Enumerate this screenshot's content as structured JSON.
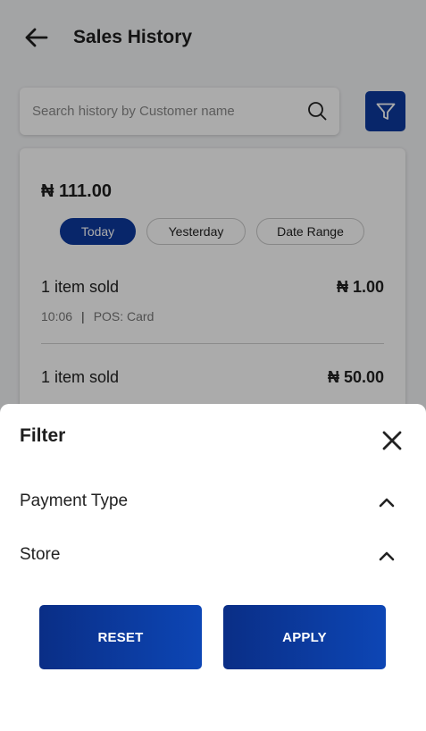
{
  "header": {
    "title": "Sales History"
  },
  "search": {
    "placeholder": "Search history by Customer name"
  },
  "summary": {
    "total": "₦ 111.00"
  },
  "period_tabs": [
    {
      "label": "Today",
      "active": true
    },
    {
      "label": "Yesterday",
      "active": false
    },
    {
      "label": "Date Range",
      "active": false
    }
  ],
  "transactions": [
    {
      "items": "1 item sold",
      "amount": "₦ 1.00",
      "time": "10:06",
      "separator": "|",
      "payment": "POS: Card"
    },
    {
      "items": "1 item sold",
      "amount": "₦ 50.00"
    }
  ],
  "filter_sheet": {
    "title": "Filter",
    "sections": [
      {
        "label": "Payment Type",
        "expanded": true
      },
      {
        "label": "Store",
        "expanded": true
      }
    ],
    "reset_label": "RESET",
    "apply_label": "APPLY"
  },
  "colors": {
    "primary": "#0d3a9e",
    "overlay": "rgba(0,0,0,0.33)"
  },
  "icons": [
    "arrow-left-icon",
    "search-icon",
    "filter-icon",
    "close-icon",
    "chevron-up-icon"
  ]
}
